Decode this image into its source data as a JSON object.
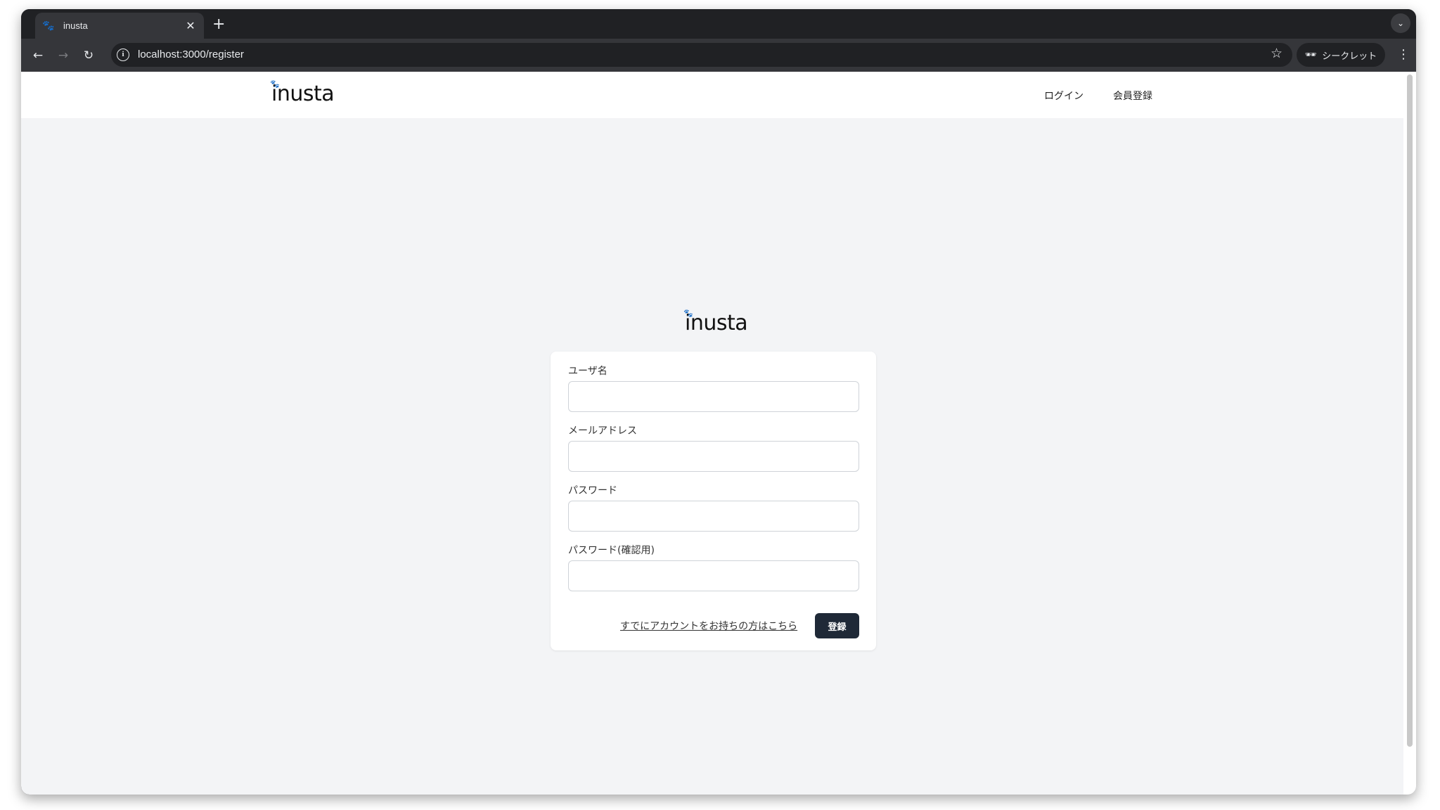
{
  "browser": {
    "tab_title": "inusta",
    "favicon": "paw-icon",
    "new_tab_label": "+",
    "url": "localhost:3000/register",
    "incognito_label": "シークレット"
  },
  "header": {
    "logo": "inusta",
    "nav": {
      "login": "ログイン",
      "register": "会員登録"
    }
  },
  "main": {
    "logo": "inusta",
    "form": {
      "username_label": "ユーザ名",
      "username_value": "",
      "email_label": "メールアドレス",
      "email_value": "",
      "password_label": "パスワード",
      "password_value": "",
      "password_confirm_label": "パスワード(確認用)",
      "password_confirm_value": "",
      "login_link": "すでにアカウントをお持ちの方はこちら",
      "submit_label": "登録"
    }
  },
  "colors": {
    "page_bg": "#f3f4f6",
    "button_bg": "#1f2937",
    "browser_chrome": "#35363a"
  }
}
